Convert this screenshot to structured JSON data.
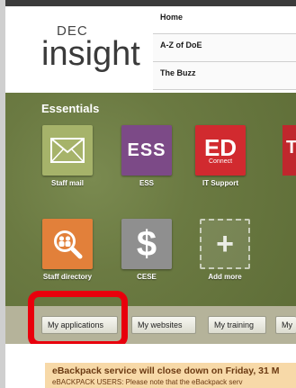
{
  "logo": {
    "dec": "DEC",
    "insight": "insight"
  },
  "nav": {
    "items": [
      "Home",
      "A-Z of DoE",
      "The Buzz"
    ]
  },
  "essentials": {
    "title": "Essentials",
    "tiles": [
      {
        "label": "Staff mail",
        "icon": "envelope-icon",
        "color": "#a6b36a"
      },
      {
        "label": "ESS",
        "icon": "ess-icon",
        "color": "#7c4a87",
        "text": "ESS"
      },
      {
        "label": "IT Support",
        "icon": "ed-connect-icon",
        "color": "#d12a2f",
        "text": "ED",
        "sub": "Connect"
      },
      {
        "label": "Staff directory",
        "icon": "people-search-icon",
        "color": "#e2803a"
      },
      {
        "label": "CESE",
        "icon": "dollar-icon",
        "color": "#8f8f8f"
      },
      {
        "label": "Add more",
        "icon": "plus-icon"
      }
    ]
  },
  "tabs": [
    "My applications",
    "My websites",
    "My training",
    "My"
  ],
  "notice": {
    "headline": "eBackpack service will close down on Friday, 31 M",
    "body": "eBACKPACK USERS: Please note that the eBackpack serv"
  }
}
